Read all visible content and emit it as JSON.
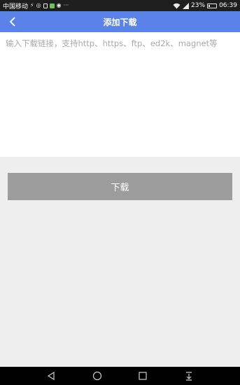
{
  "status_bar": {
    "carrier": "中国移动",
    "battery_text": "23%",
    "battery_level": 0.23,
    "time": "06:39",
    "icons": [
      "lightning-icon",
      "wechat-icon",
      "notification-icon",
      "image-icon",
      "app-icon",
      "more-dots-icon",
      "wifi-icon",
      "signal-icon",
      "battery-icon"
    ]
  },
  "app_bar": {
    "title": "添加下载",
    "back_icon": "chevron-left-icon",
    "background": "#5b82e8"
  },
  "input": {
    "value": "",
    "placeholder": "输入下载链接，支持http、https、ftp、ed2k、magnet等"
  },
  "download_button": {
    "label": "下载",
    "background": "#9d9d9d"
  },
  "nav_bar": {
    "icons": [
      "back-triangle-icon",
      "home-circle-icon",
      "recents-square-icon",
      "notification-pulldown-icon"
    ]
  }
}
